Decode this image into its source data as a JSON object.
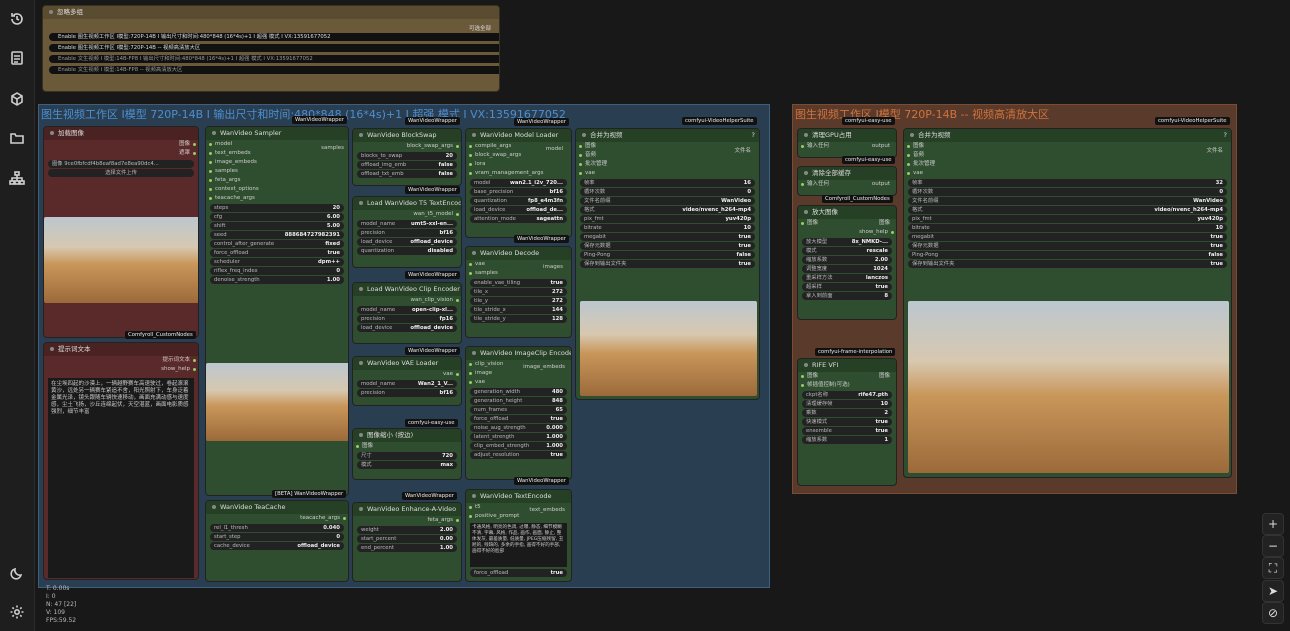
{
  "sidebar": {
    "icons": [
      "history-icon",
      "document-icon",
      "box-icon",
      "folder-icon",
      "node-tree-icon",
      "moon-icon",
      "gear-icon"
    ]
  },
  "bypass_panel": {
    "title": "忽略多组",
    "top_label": "可选全部",
    "rows": [
      {
        "label": "Enable 图生视频工作区 I模型:720P-14B  I  输出尺寸和时间:480*848  (16*4s)+1  I  超强 模式 I VX:13591677052",
        "value": "yes"
      },
      {
        "label": "Enable 图生视频工作区 I模型:720P-14B -- 视频高清放大区",
        "value": "yes"
      },
      {
        "label": "Enable 文生视频 I 模型:14B-FP8  I  输出尺寸和时间:480*848  (16*4s)+1  I  超强 模式 I VX:13591677052",
        "value": "no"
      },
      {
        "label": "Enable 文生视频 I 模型:14B-FP8 -- 视频高清放大区",
        "value": "no"
      }
    ]
  },
  "group_main": {
    "title": "图生视频工作区 I模型 720P-14B  I 输出尺寸和时间:480*848  (16*4s)+1  I 超强 模式 I VX:13591677052"
  },
  "group_upscale": {
    "title": "图生视频工作区 I模型 720P-14B -- 视频高清放大区"
  },
  "nodes": {
    "load_image": {
      "title": "加载图像",
      "out1": "图像",
      "out2": "遮罩",
      "file": "图像 9ce0fbfcdf4b8eaf8ad7e8ea90dc4...",
      "upload": "选择文件上传",
      "tag": "Comfyroll_CustomNodes"
    },
    "prompt_text": {
      "title": "提示词文本",
      "out": "提示词文本",
      "show_help": "show_help",
      "text": "在尘埃四起的沙漠上，一辆越野赛车高速驶过，卷起滚滚黄沙，远处另一辆赛车紧追不舍，阳光照射下，车身泛着金属光泽，镜头跟随车辆快速移动，画面充满动感与速度感，尘土飞扬，沙丘连绵起伏，天空湛蓝，画面电影质感强烈，细节丰富"
    },
    "sampler": {
      "title": "WanVideo Sampler",
      "tag": "WanVideoWrapper",
      "inputs": [
        "model",
        "text_embeds",
        "image_embeds",
        "samples",
        "feta_args",
        "context_options",
        "teacache_args"
      ],
      "out": "samples",
      "widgets": [
        [
          "steps",
          "20"
        ],
        [
          "cfg",
          "6.00"
        ],
        [
          "shift",
          "5.00"
        ],
        [
          "seed",
          "888684727982391"
        ],
        [
          "control_after_generate",
          "fixed"
        ],
        [
          "force_offload",
          "true"
        ],
        [
          "scheduler",
          "dpm++"
        ],
        [
          "riflex_freq_index",
          "0"
        ],
        [
          "denoise_strength",
          "1.00"
        ]
      ],
      "footer": "[BETA] WanVideoWrapper"
    },
    "teacache": {
      "title": "WanVideo TeaCache",
      "out": "teacache_args",
      "widgets": [
        [
          "rel_l1_thresh",
          "0.040"
        ],
        [
          "start_step",
          "0"
        ],
        [
          "cache_device",
          "offload_device"
        ]
      ]
    },
    "blockswap": {
      "title": "WanVideo BlockSwap",
      "out": "block_swap_args",
      "tag": "WanVideoWrapper",
      "widgets": [
        [
          "blocks_to_swap",
          "20"
        ],
        [
          "offload_img_emb",
          "false"
        ],
        [
          "offload_txt_emb",
          "false"
        ]
      ]
    },
    "t5": {
      "title": "Load WanVideo T5 TextEncoder",
      "out": "wan_t5_model",
      "tag": "WanVideoWrapper",
      "widgets": [
        [
          "model_name",
          "umt5-xxl-en..."
        ],
        [
          "precision",
          "bf16"
        ],
        [
          "load_device",
          "offload_device"
        ],
        [
          "quantization",
          "disabled"
        ]
      ]
    },
    "clipenc": {
      "title": "Load WanVideo Clip Encoder",
      "out": "wan_clip_vision",
      "tag": "WanVideoWrapper",
      "widgets": [
        [
          "model_name",
          "open-clip-xl..."
        ],
        [
          "precision",
          "fp16"
        ],
        [
          "load_device",
          "offload_device"
        ]
      ]
    },
    "vae": {
      "title": "WanVideo VAE Loader",
      "out": "vae",
      "tag": "comfyui-easy-use",
      "widgets": [
        [
          "model_name",
          "Wan2_1_V..."
        ],
        [
          "precision",
          "bf16"
        ]
      ]
    },
    "resize": {
      "title": "图像缩小 (按边)",
      "in": "图像",
      "out": "图像",
      "widgets": [
        [
          "尺寸",
          "720"
        ],
        [
          "模式",
          "max"
        ]
      ],
      "tag": "WanVideoWrapper"
    },
    "enhance": {
      "title": "WanVideo Enhance-A-Video",
      "out": "feta_args",
      "widgets": [
        [
          "weight",
          "2.00"
        ],
        [
          "start_percent",
          "0.00"
        ],
        [
          "end_percent",
          "1.00"
        ]
      ]
    },
    "modelloader": {
      "title": "WanVideo Model Loader",
      "tag": "WanVideoWrapper",
      "inputs": [
        "compile_args",
        "block_swap_args",
        "lora",
        "vram_management_args"
      ],
      "out": "model",
      "widgets": [
        [
          "model",
          "wan2.1_i2v_720..."
        ],
        [
          "base_precision",
          "bf16"
        ],
        [
          "quantization",
          "fp8_e4m3fn"
        ],
        [
          "load_device",
          "offload_de..."
        ],
        [
          "attention_mode",
          "sageattn"
        ]
      ]
    },
    "decode": {
      "title": "WanVideo Decode",
      "inputs": [
        "vae",
        "samples"
      ],
      "out": "images",
      "widgets": [
        [
          "enable_vae_tiling",
          "true"
        ],
        [
          "tile_x",
          "272"
        ],
        [
          "tile_y",
          "272"
        ],
        [
          "tile_stride_x",
          "144"
        ],
        [
          "tile_stride_y",
          "128"
        ]
      ]
    },
    "imageclip": {
      "title": "WanVideo ImageClip Encode",
      "inputs": [
        "clip_vision",
        "image",
        "vae"
      ],
      "out": "image_embeds",
      "tag": "WanVideoWrapper",
      "widgets": [
        [
          "generation_width",
          "480"
        ],
        [
          "generation_height",
          "848"
        ],
        [
          "num_frames",
          "65"
        ],
        [
          "force_offload",
          "true"
        ],
        [
          "noise_aug_strength",
          "0.000"
        ],
        [
          "latent_strength",
          "1.000"
        ],
        [
          "clip_embed_strength",
          "1.000"
        ],
        [
          "adjust_resolution",
          "true"
        ]
      ]
    },
    "textencode": {
      "title": "WanVideo TextEncode",
      "in": "t5",
      "out": "text_embeds",
      "positive": "positive_prompt",
      "text": "卡通风格, 明亮的色调, 过曝, 静态, 细节模糊不清, 字幕, 风格, 作品, 画作, 画面, 静止, 整体发灰, 最差质量, 低质量, JPEG压缩残留, 丑陋的, 残缺的, 多余的手指, 画得不好的手部, 画得不好的脸部",
      "widget": [
        "force_offload",
        "true"
      ]
    },
    "combine": {
      "title": "合并为视频",
      "tag": "comfyui-VideoHelperSuite",
      "inputs": [
        "图像",
        "音频",
        "批次管理",
        "vae"
      ],
      "out": "文件名",
      "widgets": [
        [
          "帧率",
          "16"
        ],
        [
          "循环次数",
          "0"
        ],
        [
          "文件名前缀",
          "WanVideo"
        ],
        [
          "格式",
          "video/nvenc_h264-mp4"
        ],
        [
          "pix_fmt",
          "yuv420p"
        ],
        [
          "bitrate",
          "10"
        ],
        [
          "megabit",
          "true"
        ],
        [
          "保存元数据",
          "true"
        ],
        [
          "Ping-Pong",
          "false"
        ],
        [
          "保存到输出文件夹",
          "true"
        ]
      ]
    },
    "gpu_clear": {
      "title": "清理GPU占用",
      "tag": "comfyui-easy-use",
      "in": "输入任何",
      "out": "output"
    },
    "mem_clear": {
      "title": "清除全部缓存",
      "tag": "comfyui-easy-use",
      "in": "输入任何",
      "out": "output"
    },
    "upscale": {
      "title": "放大图像",
      "tag": "Comfyroll_CustomNodes",
      "in": "图像",
      "out": "图像",
      "show_help": "show_help",
      "widgets": [
        [
          "放大模型",
          "8x_NMKD-..."
        ],
        [
          "模式",
          "rescale"
        ],
        [
          "缩放系数",
          "2.00"
        ],
        [
          "调整宽度",
          "1024"
        ],
        [
          "重采样方法",
          "lanczos"
        ],
        [
          "超采样",
          "true"
        ],
        [
          "拿入到前面",
          "8"
        ]
      ]
    },
    "rife": {
      "title": "RIFE VFI",
      "tag": "comfyui-frame-interpolation",
      "inputs": [
        "图像",
        "帧插值控制(可选)"
      ],
      "out": "图像",
      "widgets": [
        [
          "ckpt名称",
          "rife47.pth"
        ],
        [
          "清理缓存帧",
          "10"
        ],
        [
          "乘数",
          "2"
        ],
        [
          "快速模式",
          "true"
        ],
        [
          "ensemble",
          "true"
        ],
        [
          "缩放系数",
          "1"
        ]
      ]
    },
    "combine2": {
      "title": "合并为视频",
      "tag": "comfyui-VideoHelperSuite",
      "inputs": [
        "图像",
        "音频",
        "批次管理",
        "vae"
      ],
      "out": "文件名",
      "widgets": [
        [
          "帧率",
          "32"
        ],
        [
          "循环次数",
          "0"
        ],
        [
          "文件名前缀",
          "WanVideo"
        ],
        [
          "格式",
          "video/nvenc_h264-mp4"
        ],
        [
          "pix_fmt",
          "yuv420p"
        ],
        [
          "bitrate",
          "10"
        ],
        [
          "megabit",
          "true"
        ],
        [
          "保存元数据",
          "true"
        ],
        [
          "Ping-Pong",
          "false"
        ],
        [
          "保存到输出文件夹",
          "true"
        ]
      ]
    }
  },
  "stats": [
    "T: 0.00s",
    "I: 0",
    "N: 47 [22]",
    "V: 109",
    "FPS:59.52"
  ],
  "canvas_controls": [
    "zoom-in-icon",
    "zoom-out-icon",
    "fit-view-icon",
    "locate-icon",
    "hide-links-icon"
  ]
}
